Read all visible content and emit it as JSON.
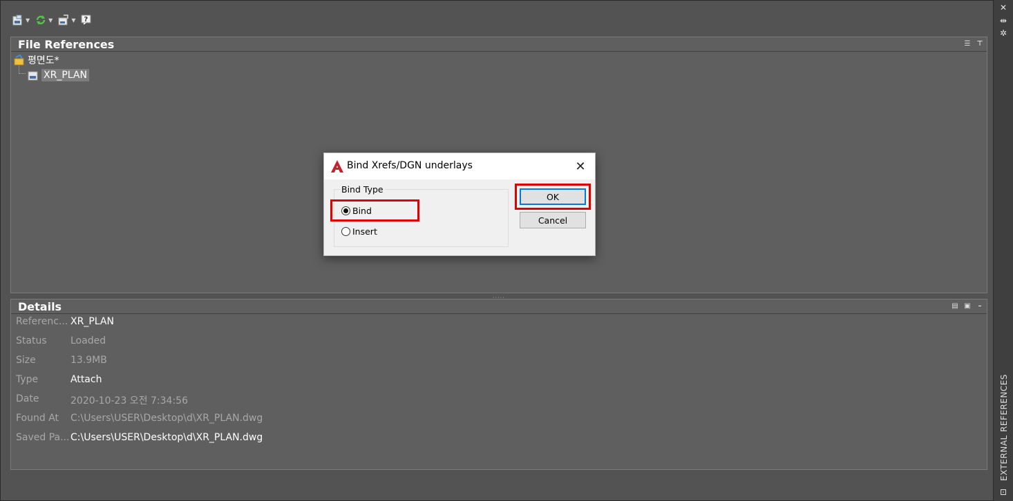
{
  "palette_title": "EXTERNAL REFERENCES",
  "toolbar": {
    "buttons": [
      {
        "icon": "attach-dwg-icon",
        "has_dropdown": true
      },
      {
        "icon": "refresh-icon",
        "has_dropdown": true
      },
      {
        "icon": "change-path-icon",
        "has_dropdown": true
      },
      {
        "icon": "help-icon",
        "has_dropdown": false
      }
    ]
  },
  "file_references": {
    "title": "File References",
    "tree": {
      "root": {
        "label": "평면도*"
      },
      "children": [
        {
          "label": "XR_PLAN",
          "selected": true
        }
      ]
    }
  },
  "details": {
    "title": "Details",
    "rows": [
      {
        "label": "Referenc...",
        "value": "XR_PLAN",
        "editable": true
      },
      {
        "label": "Status",
        "value": "Loaded",
        "editable": false
      },
      {
        "label": "Size",
        "value": "13.9MB",
        "editable": false
      },
      {
        "label": "Type",
        "value": "Attach",
        "editable": true
      },
      {
        "label": "Date",
        "value": "2020-10-23 오전 7:34:56",
        "editable": false
      },
      {
        "label": "Found At",
        "value": "C:\\Users\\USER\\Desktop\\d\\XR_PLAN.dwg",
        "editable": false
      },
      {
        "label": "Saved Pa...",
        "value": "C:\\Users\\USER\\Desktop\\d\\XR_PLAN.dwg",
        "editable": true
      }
    ]
  },
  "dialog": {
    "title": "Bind Xrefs/DGN underlays",
    "group_label": "Bind Type",
    "options": [
      {
        "label": "Bind",
        "selected": true
      },
      {
        "label": "Insert",
        "selected": false
      }
    ],
    "ok_label": "OK",
    "cancel_label": "Cancel"
  },
  "colors": {
    "highlight": "#e00000",
    "palette_bg": "#535353",
    "accent": "#0078d7",
    "autocad_red": "#c8202f"
  }
}
